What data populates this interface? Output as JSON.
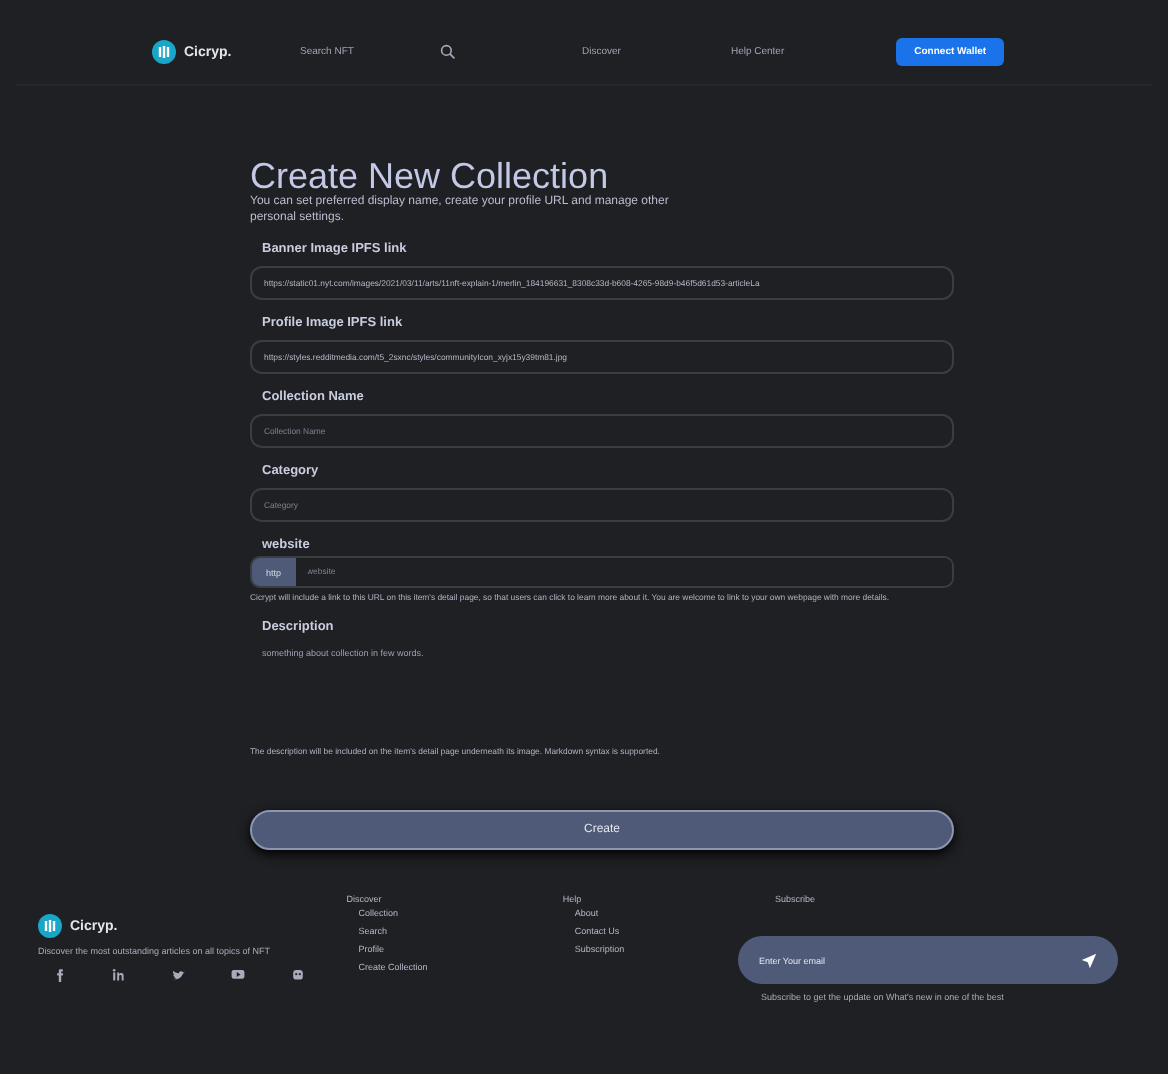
{
  "header": {
    "brand": "Cicryp.",
    "search_placeholder": "Search NFT",
    "nav": [
      "Discover",
      "Help Center"
    ],
    "button": "Connect Wallet"
  },
  "form": {
    "title": "Create New Collection",
    "subtitle": "You can set preferred display name, create your profile URL and manage other personal settings.",
    "fields": [
      {
        "kind": "input",
        "label": "Banner Image IPFS link",
        "value": "https://static01.nyt.com/images/2021/03/11/arts/11nft-explain-1/merlin_184196631_8308c33d-b608-4265-98d9-b46f5d61d53-articleLa"
      },
      {
        "kind": "input",
        "label": "Profile Image IPFS link",
        "value": "https://styles.redditmedia.com/t5_2sxnc/styles/communityIcon_xyjx15y39tm81.jpg"
      },
      {
        "kind": "input",
        "label": "Collection Name",
        "placeholder": "Collection Name"
      },
      {
        "kind": "input",
        "label": "Category",
        "placeholder": "Category"
      },
      {
        "kind": "url",
        "label": "website",
        "prefix": "http",
        "placeholder": "website",
        "help": "Cicrypt will include a link to this URL on this item's detail page, so that users can click to learn more about it. You are welcome to link to your own webpage with more details."
      },
      {
        "kind": "textarea",
        "label": "Description",
        "placeholder": "something about collection in few words.",
        "help": "The description will be included on the item's detail page underneath its image. Markdown syntax is supported."
      }
    ],
    "button": "Create"
  },
  "footer": {
    "brand": "Cicryp.",
    "tagline": "Discover the most outstanding articles on all topics of NFT",
    "columns": [
      {
        "heading": "Discover",
        "links": [
          "Collection",
          "Search",
          "Profile",
          "Create Collection"
        ]
      },
      {
        "heading": "Help",
        "links": [
          "About",
          "Contact Us",
          "Subscription"
        ]
      }
    ],
    "subscribe": {
      "heading": "Subscribe",
      "placeholder": "Enter Your email",
      "note": "Subscribe to get the update on What's new in one of the best"
    }
  }
}
